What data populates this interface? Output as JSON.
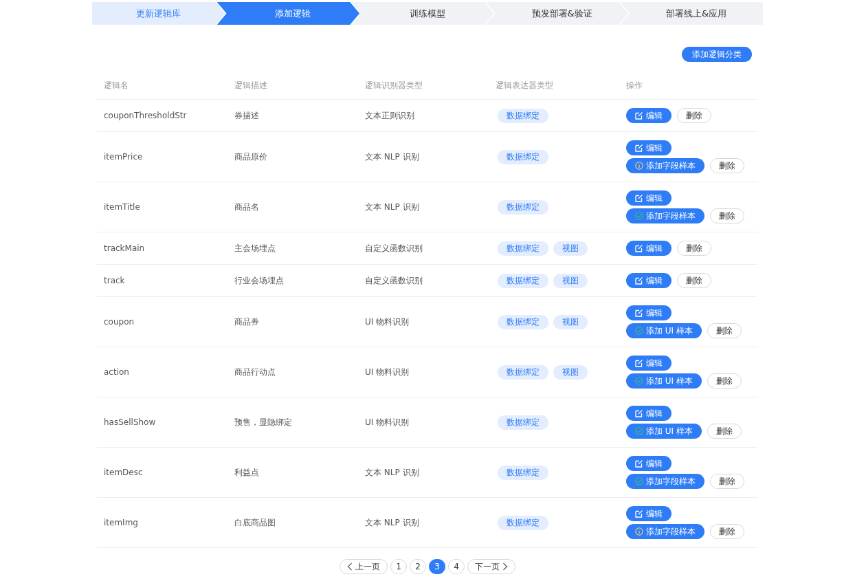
{
  "steps": [
    {
      "label": "更新逻辑库",
      "selected": false,
      "done": true
    },
    {
      "label": "添加逻辑",
      "selected": true,
      "done": false
    },
    {
      "label": "训练模型",
      "selected": false,
      "done": false
    },
    {
      "label": "预发部署&验证",
      "selected": false,
      "done": false
    },
    {
      "label": "部署线上&应用",
      "selected": false,
      "done": false
    }
  ],
  "add_category_button": "添加逻辑分类",
  "table": {
    "columns": [
      "逻辑名",
      "逻辑描述",
      "逻辑识别器类型",
      "逻辑表达器类型",
      "操作"
    ],
    "rows": [
      {
        "name": "couponThresholdStr",
        "description": "券描述",
        "recognizer": "文本正则识别",
        "expressors": [
          "数据绑定"
        ],
        "edit": "编辑",
        "delete": "删除"
      },
      {
        "name": "itemPrice",
        "description": "商品原价",
        "recognizer": "文本 NLP 识别",
        "expressors": [
          "数据绑定"
        ],
        "edit": "编辑",
        "sample": {
          "label": "添加字段样本",
          "kind": "info"
        },
        "delete": "删除"
      },
      {
        "name": "itemTitle",
        "description": "商品名",
        "recognizer": "文本 NLP 识别",
        "expressors": [
          "数据绑定"
        ],
        "edit": "编辑",
        "sample": {
          "label": "添加字段样本",
          "kind": "done"
        },
        "delete": "删除"
      },
      {
        "name": "trackMain",
        "description": "主会场埋点",
        "recognizer": "自定义函数识别",
        "expressors": [
          "数据绑定",
          "视图"
        ],
        "edit": "编辑",
        "delete": "删除"
      },
      {
        "name": "track",
        "description": "行业会场埋点",
        "recognizer": "自定义函数识别",
        "expressors": [
          "数据绑定",
          "视图"
        ],
        "edit": "编辑",
        "delete": "删除"
      },
      {
        "name": "coupon",
        "description": "商品券",
        "recognizer": "UI 物料识别",
        "expressors": [
          "数据绑定",
          "视图"
        ],
        "edit": "编辑",
        "sample": {
          "label": "添加 UI 样本",
          "kind": "done"
        },
        "delete": "删除"
      },
      {
        "name": "action",
        "description": "商品行动点",
        "recognizer": "UI 物料识别",
        "expressors": [
          "数据绑定",
          "视图"
        ],
        "edit": "编辑",
        "sample": {
          "label": "添加 UI 样本",
          "kind": "done"
        },
        "delete": "删除"
      },
      {
        "name": "hasSellShow",
        "description": "预售，显隐绑定",
        "recognizer": "UI 物料识别",
        "expressors": [
          "数据绑定"
        ],
        "edit": "编辑",
        "sample": {
          "label": "添加 UI 样本",
          "kind": "done"
        },
        "delete": "删除"
      },
      {
        "name": "itemDesc",
        "description": "利益点",
        "recognizer": "文本 NLP 识别",
        "expressors": [
          "数据绑定"
        ],
        "edit": "编辑",
        "sample": {
          "label": "添加字段样本",
          "kind": "done"
        },
        "delete": "删除"
      },
      {
        "name": "itemImg",
        "description": "白底商品图",
        "recognizer": "文本 NLP 识别",
        "expressors": [
          "数据绑定"
        ],
        "edit": "编辑",
        "sample": {
          "label": "添加字段样本",
          "kind": "info"
        },
        "delete": "删除"
      }
    ]
  },
  "pagination": {
    "prev": "上一页",
    "next": "下一页",
    "pages": [
      {
        "label": "1",
        "selected": false
      },
      {
        "label": "2",
        "selected": false
      },
      {
        "label": "3",
        "selected": true
      },
      {
        "label": "4",
        "selected": false
      }
    ]
  }
}
